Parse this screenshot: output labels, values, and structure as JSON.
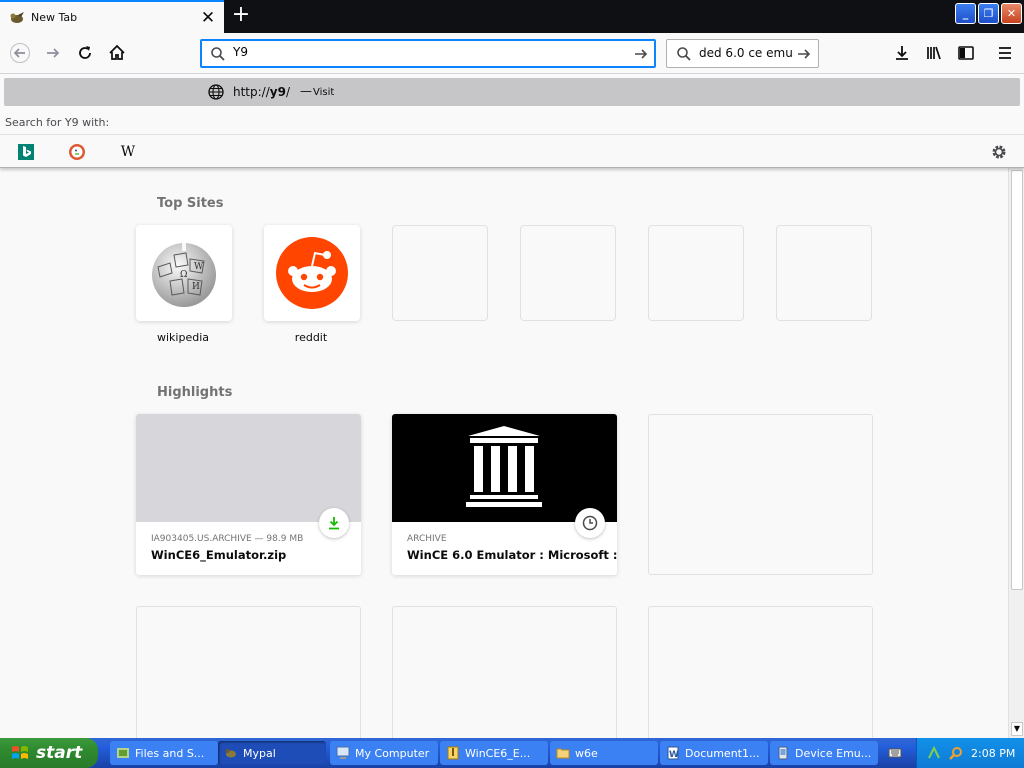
{
  "browser": {
    "tab": {
      "title": "New Tab",
      "close_glyph": "✕"
    },
    "new_tab_glyph": "+",
    "window_controls": {
      "minimize": "_",
      "restore": "❐",
      "close": "✕"
    },
    "urlbar": {
      "value": "Y9"
    },
    "searchbar": {
      "value": "ded 6.0 ce emu"
    }
  },
  "dropdown": {
    "suggestion": {
      "url_prefix": "http://",
      "url_bold": "y9",
      "url_suffix": "/",
      "dash": "—",
      "action": "Visit"
    },
    "search_with_label": "Search for Y9 with:",
    "engines": [
      "bing-icon",
      "duckduckgo-icon",
      "wikipedia-icon"
    ],
    "wikipedia_glyph": "W"
  },
  "newtab": {
    "top_sites_title": "Top Sites",
    "top_sites": [
      {
        "label": "wikipedia"
      },
      {
        "label": "reddit"
      }
    ],
    "highlights_title": "Highlights",
    "highlights": [
      {
        "meta": "IA903405.US.ARCHIVE — 98.9 MB",
        "title": "WinCE6_Emulator.zip"
      },
      {
        "meta": "ARCHIVE",
        "title": "WinCE 6.0 Emulator : Microsoft : ..."
      }
    ]
  },
  "taskbar": {
    "start_label": "start",
    "tasks": [
      {
        "label": "Files and S..."
      },
      {
        "label": "Mypal"
      },
      {
        "label": "My Computer"
      },
      {
        "label": "WinCE6_E..."
      },
      {
        "label": "w6e"
      },
      {
        "label": "Document1..."
      },
      {
        "label": "Device Emu..."
      }
    ],
    "clock": "2:08 PM"
  },
  "colors": {
    "accent": "#0a84ff",
    "reddit": "#ff4500",
    "download": "#12bc00",
    "xp_blue": "#245edb",
    "xp_green": "#3c9a3c"
  }
}
